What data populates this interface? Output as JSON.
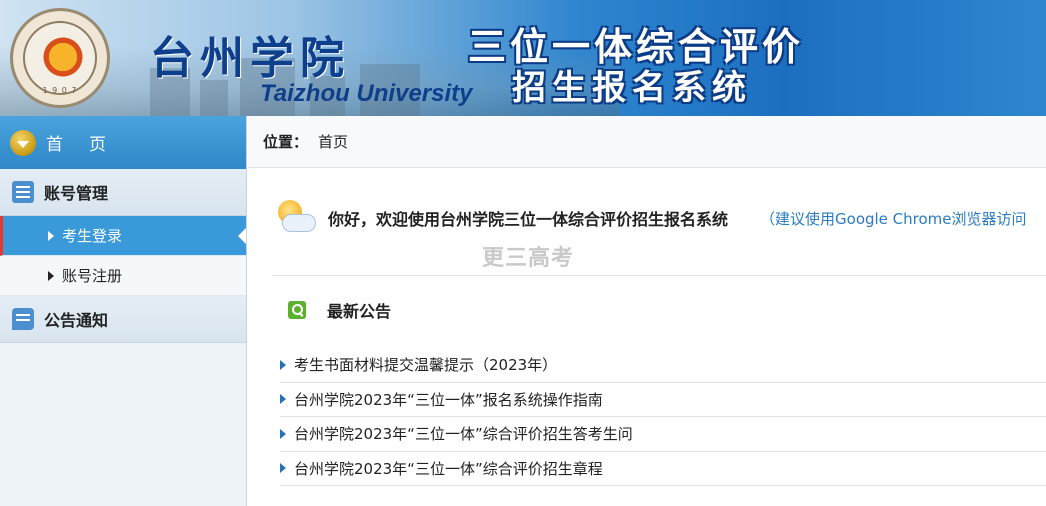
{
  "header": {
    "chinese_name": "台州学院",
    "english_name": "Taizhou University",
    "system_title_line1": "三位一体综合评价",
    "system_title_line2": "招生报名系统",
    "logo_ring_text": "1 9 0 7"
  },
  "sidebar": {
    "home_label": "首页",
    "groups": [
      {
        "label": "账号管理",
        "items": [
          {
            "label": "考生登录",
            "active": true
          },
          {
            "label": "账号注册",
            "active": false
          }
        ]
      },
      {
        "label": "公告通知",
        "items": []
      }
    ]
  },
  "breadcrumb": {
    "label": "位置：",
    "current": "首页"
  },
  "welcome": {
    "text": "你好，欢迎使用台州学院三位一体综合评价招生报名系统",
    "browser_tip": "（建议使用Google Chrome浏览器访问"
  },
  "watermark": "更三高考",
  "news": {
    "title": "最新公告",
    "items": [
      "考生书面材料提交温馨提示（2023年）",
      "台州学院2023年“三位一体”报名系统操作指南",
      "台州学院2023年“三位一体”综合评价招生答考生问",
      "台州学院2023年“三位一体”综合评价招生章程"
    ]
  },
  "colors": {
    "sidebar_active": "#3a9ad9",
    "header_dark_blue": "#0e3f8c",
    "link_blue": "#2a7bbf"
  },
  "icons": {
    "home": "chevron-down-circle-icon",
    "account_group": "list-icon",
    "notice_group": "chat-bubble-icon",
    "welcome": "sun-cloud-icon",
    "news": "search-icon"
  }
}
